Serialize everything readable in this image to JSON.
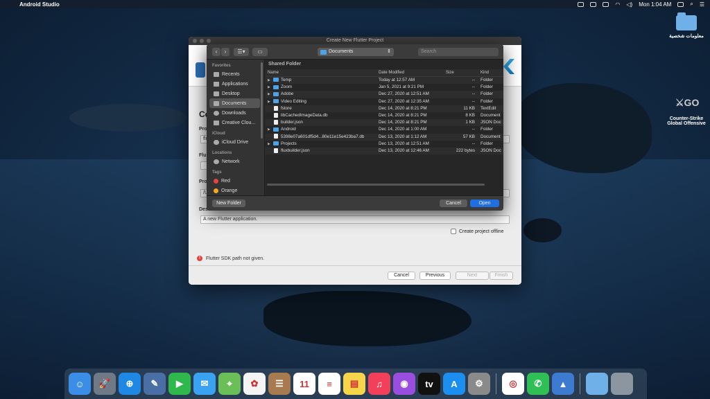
{
  "menubar": {
    "app_name": "Android Studio",
    "time": "Mon 1:04 AM"
  },
  "desktop": {
    "icons": [
      {
        "label": "معلومات شخصية",
        "type": "folder"
      },
      {
        "label": "Counter-Strike Global Offensive",
        "type": "game"
      }
    ]
  },
  "main_dialog": {
    "window_title": "Create New Flutter Project",
    "title_partial": "Co",
    "label_name": "Pro",
    "name_value": "flu",
    "label_flutter": "Flu",
    "label_project": "Pro",
    "project_location": "/U",
    "label_description": "Des",
    "description_value": "A new Flutter application.",
    "offline_label": "Create project offline",
    "sdk_error": "Flutter SDK path not given.",
    "buttons": {
      "cancel": "Cancel",
      "previous": "Previous",
      "next": "Next",
      "finish": "Finish"
    }
  },
  "file_dialog": {
    "location": "Documents",
    "search_placeholder": "Search",
    "list_header": "Shared Folder",
    "sidebar": {
      "favorites_title": "Favorites",
      "favorites": [
        "Recents",
        "Applications",
        "Desktop",
        "Documents",
        "Downloads",
        "Creative Clou..."
      ],
      "icloud_title": "iCloud",
      "icloud": [
        "iCloud Drive"
      ],
      "locations_title": "Locations",
      "locations": [
        "Network"
      ],
      "tags_title": "Tags",
      "tags": [
        {
          "label": "Red",
          "color": "#e5453f"
        },
        {
          "label": "Orange",
          "color": "#f5a623"
        }
      ]
    },
    "columns": {
      "name": "Name",
      "date": "Date Modified",
      "size": "Size",
      "kind": "Kind"
    },
    "rows": [
      {
        "name": "Temp",
        "date": "Today at 12:57 AM",
        "size": "--",
        "kind": "Folder",
        "folder": true
      },
      {
        "name": "Zoom",
        "date": "Jan 5, 2021 at 9:21 PM",
        "size": "--",
        "kind": "Folder",
        "folder": true
      },
      {
        "name": "Adobe",
        "date": "Dec 27, 2020 at 12:51 AM",
        "size": "--",
        "kind": "Folder",
        "folder": true
      },
      {
        "name": "Video Editing",
        "date": "Dec 27, 2020 at 12:35 AM",
        "size": "--",
        "kind": "Folder",
        "folder": true
      },
      {
        "name": "fstore",
        "date": "Dec 14, 2020 at 8:21 PM",
        "size": "11 KB",
        "kind": "TextEdit",
        "folder": false
      },
      {
        "name": "libCachedImageData.db",
        "date": "Dec 14, 2020 at 8:21 PM",
        "size": "8 KB",
        "kind": "Document",
        "folder": false
      },
      {
        "name": "builder.json",
        "date": "Dec 14, 2020 at 8:21 PM",
        "size": "1 KB",
        "kind": "JSON Doc",
        "folder": false
      },
      {
        "name": "Android",
        "date": "Dec 14, 2020 at 1:00 AM",
        "size": "--",
        "kind": "Folder",
        "folder": true
      },
      {
        "name": "5398e07a601df5d4...80e11e15e423ba7.db",
        "date": "Dec 13, 2020 at 1:12 AM",
        "size": "57 KB",
        "kind": "Document",
        "folder": false
      },
      {
        "name": "Projects",
        "date": "Dec 13, 2020 at 12:51 AM",
        "size": "--",
        "kind": "Folder",
        "folder": true
      },
      {
        "name": "fluxbuilder.json",
        "date": "Dec 13, 2020 at 12:46 AM",
        "size": "222 bytes",
        "kind": "JSON Doc",
        "folder": false
      }
    ],
    "buttons": {
      "new_folder": "New Folder",
      "cancel": "Cancel",
      "open": "Open"
    }
  },
  "dock": {
    "apps": [
      {
        "name": "finder",
        "color": "#3b8ee8",
        "glyph": "☺"
      },
      {
        "name": "launchpad",
        "color": "#707a86",
        "glyph": "🚀"
      },
      {
        "name": "safari",
        "color": "#1f88e5",
        "glyph": "⊕"
      },
      {
        "name": "preview",
        "color": "#4a6fa5",
        "glyph": "✎"
      },
      {
        "name": "facetime",
        "color": "#2fb84b",
        "glyph": "▶"
      },
      {
        "name": "messages",
        "color": "#3aa2f0",
        "glyph": "✉"
      },
      {
        "name": "maps",
        "color": "#6bbf59",
        "glyph": "⌖"
      },
      {
        "name": "photos",
        "color": "#f4f4f4",
        "glyph": "✿"
      },
      {
        "name": "contacts",
        "color": "#a77b4f",
        "glyph": "☰"
      },
      {
        "name": "calendar",
        "color": "#ffffff",
        "glyph": "11"
      },
      {
        "name": "reminders",
        "color": "#ffffff",
        "glyph": "≡"
      },
      {
        "name": "notes",
        "color": "#f7d54a",
        "glyph": "▤"
      },
      {
        "name": "music",
        "color": "#f2405a",
        "glyph": "♫"
      },
      {
        "name": "podcasts",
        "color": "#9a4ee0",
        "glyph": "◉"
      },
      {
        "name": "apple-tv",
        "color": "#111111",
        "glyph": "tv"
      },
      {
        "name": "app-store",
        "color": "#1c8ef0",
        "glyph": "A"
      },
      {
        "name": "system-preferences",
        "color": "#8a8a8a",
        "glyph": "⚙"
      },
      {
        "name": "chrome",
        "color": "#ffffff",
        "glyph": "◎"
      },
      {
        "name": "whatsapp",
        "color": "#2fbf55",
        "glyph": "✆"
      },
      {
        "name": "android-studio",
        "color": "#3d7bd1",
        "glyph": "▲"
      }
    ]
  }
}
